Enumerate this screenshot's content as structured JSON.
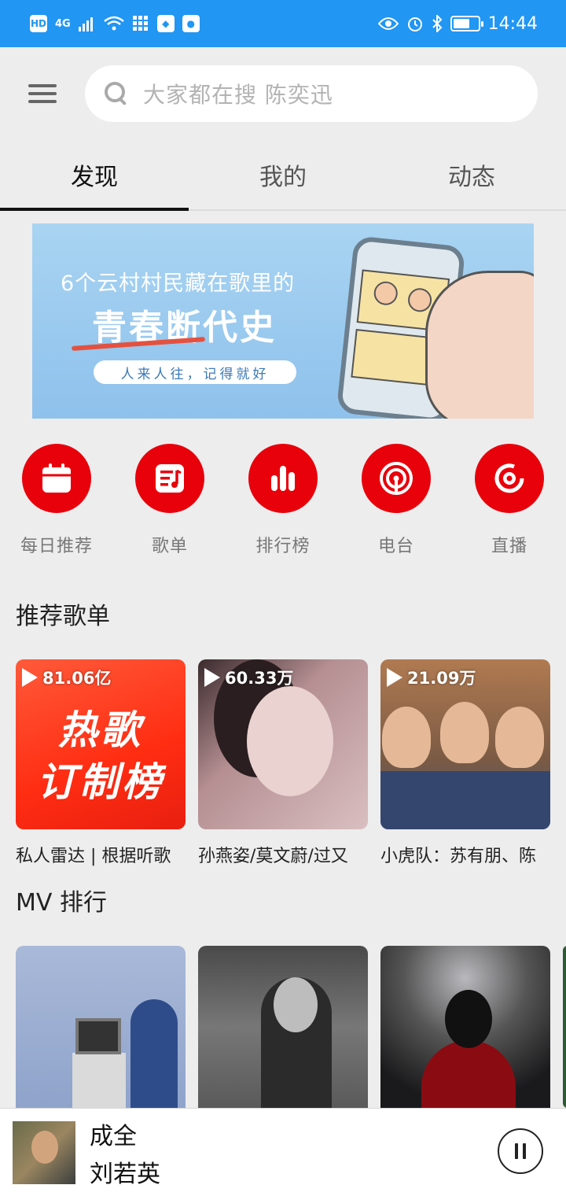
{
  "status_bar": {
    "network_badge": "HD",
    "network_type": "4G",
    "time": "14:44"
  },
  "search": {
    "placeholder": "大家都在搜 陈奕迅"
  },
  "tabs": [
    {
      "label": "发现",
      "active": true
    },
    {
      "label": "我的",
      "active": false
    },
    {
      "label": "动态",
      "active": false
    }
  ],
  "banner": {
    "line1": "6个云村村民藏在歌里的",
    "line2": "青春断代史",
    "tagline": "人来人往，记得就好",
    "dot_count": 12,
    "active_dot": 3
  },
  "entries": [
    {
      "label": "每日推荐",
      "icon": "calendar-icon"
    },
    {
      "label": "歌单",
      "icon": "playlist-icon"
    },
    {
      "label": "排行榜",
      "icon": "chart-bars-icon"
    },
    {
      "label": "电台",
      "icon": "radio-icon"
    },
    {
      "label": "直播",
      "icon": "live-icon"
    }
  ],
  "recommended": {
    "title": "推荐歌单",
    "cards": [
      {
        "count": "81.06亿",
        "title": "私人雷达 | 根据听歌",
        "cover_text_1": "热歌",
        "cover_text_2": "订制榜"
      },
      {
        "count": "60.33万",
        "title": "孙燕姿/莫文蔚/过又"
      },
      {
        "count": "21.09万",
        "title": "小虎队：苏有朋、陈"
      }
    ]
  },
  "mv_ranking": {
    "title": "MV 排行"
  },
  "player": {
    "song": "成全",
    "artist": "刘若英"
  },
  "colors": {
    "status_bar": "#2196f3",
    "accent_red": "#e8000b",
    "background": "#ededed"
  }
}
